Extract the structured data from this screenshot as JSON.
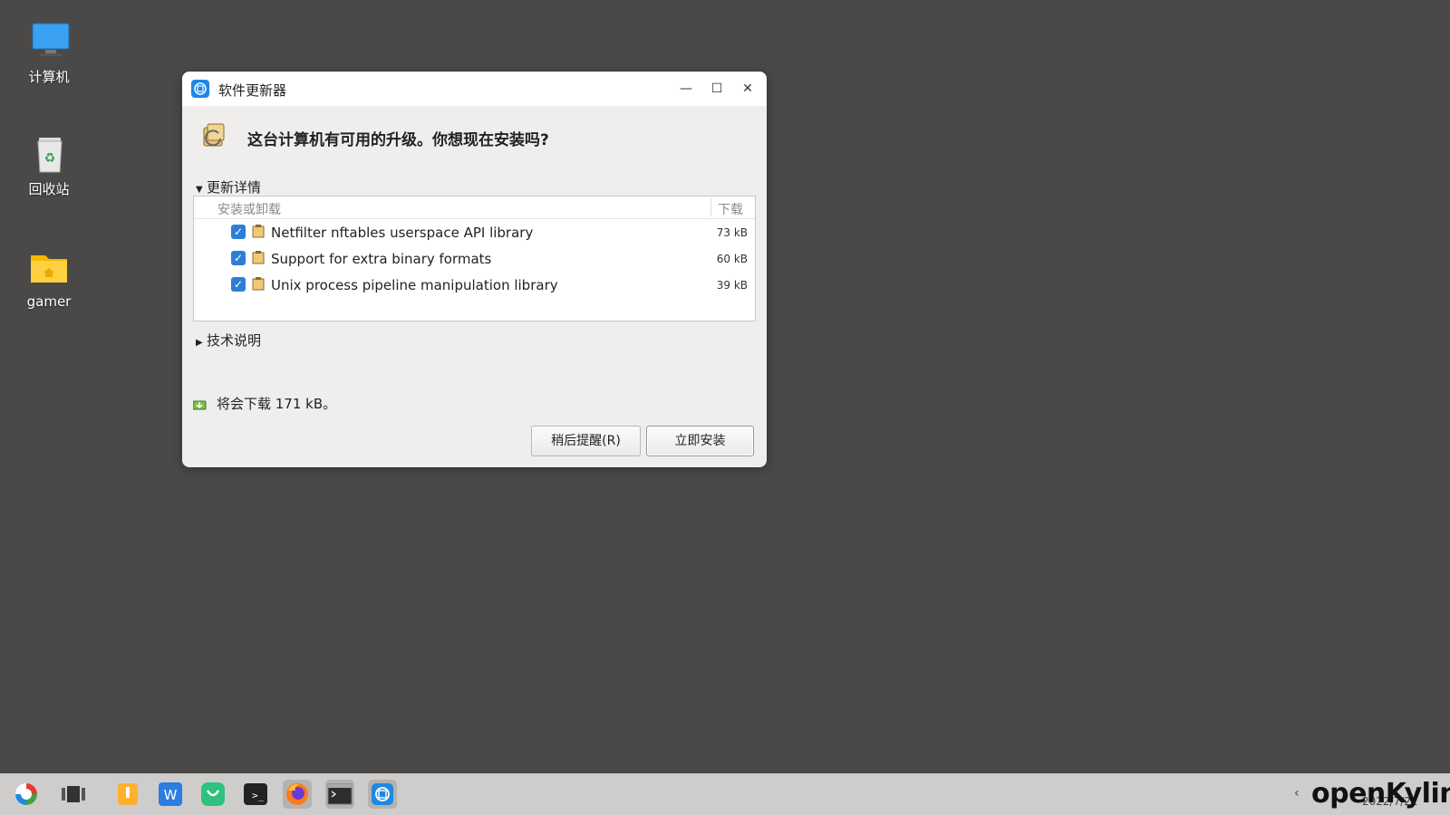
{
  "desktop": {
    "icons": [
      {
        "label": "计算机"
      },
      {
        "label": "回收站"
      },
      {
        "label": "gamer"
      }
    ]
  },
  "window": {
    "title": "软件更新器",
    "headline": "这台计算机有可用的升级。你想现在安装吗?",
    "details_label": "更新详情",
    "columns": {
      "name": "安装或卸载",
      "size": "下载"
    },
    "packages": [
      {
        "name": "Netfilter nftables userspace API library",
        "size": "73 kB",
        "checked": true
      },
      {
        "name": "Support for extra binary formats",
        "size": "60 kB",
        "checked": true
      },
      {
        "name": "Unix process pipeline manipulation library",
        "size": "39 kB",
        "checked": true
      }
    ],
    "tech_label": "技术说明",
    "download_info": "将会下载 171 kB。",
    "buttons": {
      "remind_later": "稍后提醒(R)",
      "install_now": "立即安装"
    }
  },
  "taskbar": {
    "brand": "openKylin",
    "clock": "2022/7/22"
  },
  "colors": {
    "desktop": "#4a4948",
    "accent": "#2d7fd6",
    "taskbar": "#cfcdcb"
  }
}
